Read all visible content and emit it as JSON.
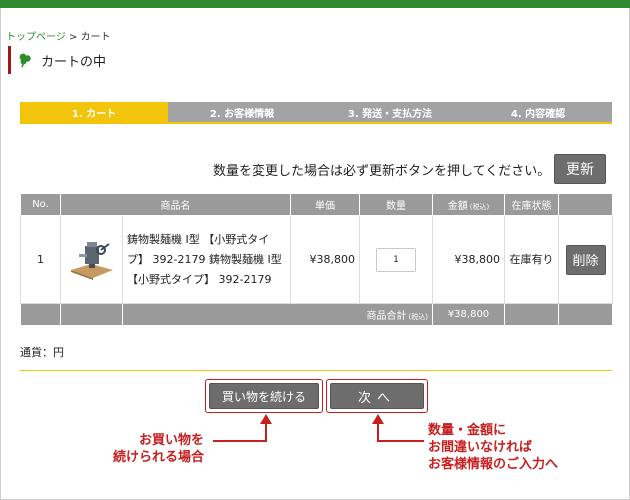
{
  "breadcrumb": {
    "home": "トップページ",
    "separator": " > ",
    "current": "カート"
  },
  "page_title": "カートの中",
  "steps": [
    {
      "label": "1. カート",
      "active": true
    },
    {
      "label": "2. お客様情報",
      "active": false
    },
    {
      "label": "3. 発送・支払方法",
      "active": false
    },
    {
      "label": "4. 内容確認",
      "active": false
    }
  ],
  "notice": "数量を変更した場合は必ず更新ボタンを押してください。",
  "update_button": "更新",
  "table": {
    "headers": {
      "no": "No.",
      "product": "商品名",
      "unit_price": "単価",
      "quantity": "数量",
      "amount": "金額",
      "amount_note": "(税込)",
      "stock": "在庫状態"
    },
    "rows": [
      {
        "no": "1",
        "name": "鋳物製麺機 Ⅰ型 【小野式タイプ】 392-2179 鋳物製麺機 Ⅰ型 【小野式タイプ】 392-2179",
        "unit_price": "¥38,800",
        "quantity": "1",
        "amount": "¥38,800",
        "stock": "在庫有り",
        "delete_label": "削除"
      }
    ],
    "summary": {
      "label": "商品合計",
      "note": "(税込)",
      "total": "¥38,800"
    }
  },
  "currency": "通貨：円",
  "buttons": {
    "continue": "買い物を続ける",
    "next": "次へ"
  },
  "annotations": {
    "left_line1": "お買い物を",
    "left_line2": "続けられる場合",
    "right_line1": "数量・金額に",
    "right_line2": "お間違いなければ",
    "right_line3": "お客様情報のご入力へ"
  },
  "colors": {
    "accent_green": "#2e8b2e",
    "step_active": "#f3c40c",
    "step_inactive": "#a3a3a3",
    "annotation_red": "#c71f1f"
  },
  "icons": {
    "title_icon": "clover-leaf-icon",
    "product_image": "noodle-machine-thumbnail"
  }
}
